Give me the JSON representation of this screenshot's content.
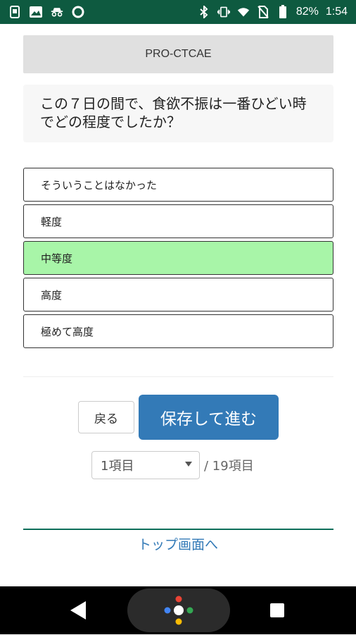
{
  "status_bar": {
    "battery": "82%",
    "time": "1:54",
    "icons": [
      "sim-icon",
      "image-icon",
      "incognito-icon",
      "circle-icon",
      "bluetooth-icon",
      "vibrate-icon",
      "wifi-icon",
      "no-sim-icon",
      "battery-icon"
    ]
  },
  "header": {
    "title": "PRO-CTCAE"
  },
  "question": {
    "text": "この７日の間で、食欲不振は一番ひどい時でどの程度でしたか？"
  },
  "options": [
    {
      "label": "そういうことはなかった",
      "selected": false
    },
    {
      "label": "軽度",
      "selected": false
    },
    {
      "label": "中等度",
      "selected": true
    },
    {
      "label": "高度",
      "selected": false
    },
    {
      "label": "極めて高度",
      "selected": false
    }
  ],
  "buttons": {
    "back": "戻る",
    "save_next": "保存して進む"
  },
  "pager": {
    "current": "1項目",
    "total": "/ 19項目"
  },
  "footer": {
    "top_link": "トップ画面へ"
  },
  "colors": {
    "status_bar": "#0e5a40",
    "selected": "#a8f5a8",
    "primary": "#337ab7"
  }
}
